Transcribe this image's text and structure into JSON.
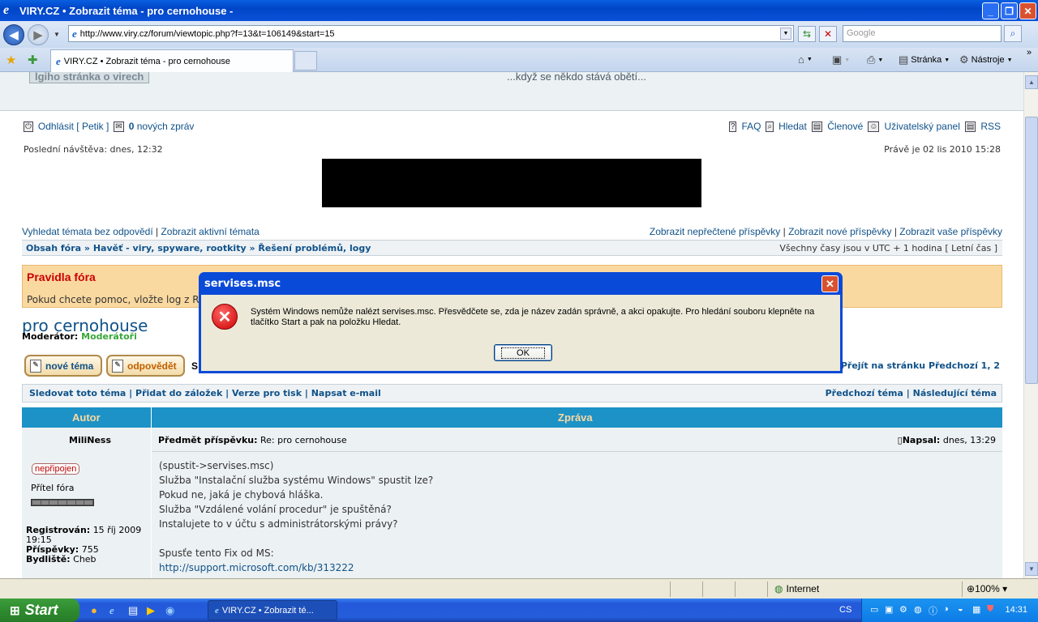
{
  "window": {
    "title": "VIRY.CZ • Zobrazit téma - pro cernohouse -"
  },
  "address": {
    "url": "http://www.viry.cz/forum/viewtopic.php?f=13&t=106149&start=15",
    "search_placeholder": "Google"
  },
  "tabs": [
    {
      "label": "VIRY.CZ • Zobrazit téma - pro cernohouse"
    }
  ],
  "toolbar": {
    "page_label": "Stránka",
    "tools_label": "Nástroje"
  },
  "site": {
    "logo_text": "lgiho stránka o virech",
    "slogan": "...když se někdo stává obětí...",
    "logout": "Odhlásit [ Petik ]",
    "new_messages_count": "0",
    "new_messages": "nových zpráv",
    "faq": "FAQ",
    "search": "Hledat",
    "members": "Členové",
    "user_panel": "Uživatelský panel",
    "rss": "RSS",
    "last_visit": "Poslední návštěva: dnes, 12:32",
    "now": "Právě je 02 lis 2010 15:28",
    "left_links": [
      "Vyhledat témata bez odpovědí",
      "Zobrazit aktivní témata"
    ],
    "right_links": [
      "Zobrazit nepřečtené příspěvky",
      "Zobrazit nové příspěvky",
      "Zobrazit vaše příspěvky"
    ],
    "breadcrumbs": [
      "Obsah fóra",
      "Havěť - viry, spyware, rootkity",
      "Řešení problémů, logy"
    ],
    "timezone": "Všechny časy jsou v UTC + 1 hodina [ Letní čas ]",
    "rules_title": "Pravidla fóra",
    "rules_text": "Pokud chcete pomoc, vložte log z RS",
    "topic_title": "pro cernohouse",
    "moderator_label": "Moderátor:",
    "moderator_value": "Moderátoři",
    "btn_new": "nové téma",
    "btn_reply": "odpovědět",
    "st_fragment": "S",
    "pagination": "Přejít na stránku Předchozí  1, 2",
    "topic_links": [
      "Sledovat toto téma",
      "Přidat do záložek",
      "Verze pro tisk",
      "Napsat e-mail"
    ],
    "topic_nav": "Předchozí téma | Následující téma",
    "col_author": "Autor",
    "col_message": "Zpráva"
  },
  "post": {
    "author": "MiliNess",
    "subject_label": "Předmět příspěvku:",
    "subject": "Re: pro cernohouse",
    "posted_label": "Napsal:",
    "posted": "dnes, 13:29",
    "status": "nepřipojen",
    "rank": "Přítel fóra",
    "registered_label": "Registrován:",
    "registered": "15 říj 2009",
    "registered_time": "19:15",
    "posts_label": "Příspěvky:",
    "posts": "755",
    "location_label": "Bydliště:",
    "location": "Cheb",
    "body": [
      "(spustit->servises.msc)",
      "Služba \"Instalační služba systému Windows\" spustit lze?",
      "Pokud ne, jaká je chybová hláška.",
      "Služba \"Vzdálené volání procedur\" je spuštěná?",
      "Instalujete to v účtu s administrátorskými právy?",
      "",
      "Spusťe tento Fix od MS:"
    ],
    "link": "http://support.microsoft.com/kb/313222"
  },
  "dialog": {
    "title": "servises.msc",
    "message": "Systém Windows nemůže nalézt servises.msc. Přesvědčete se, zda je název zadán správně, a akci opakujte. Pro hledání souboru klepněte na tlačítko Start a pak na položku Hledat.",
    "ok": "OK"
  },
  "statusbar": {
    "zone": "Internet",
    "zoom": "100%"
  },
  "taskbar": {
    "start": "Start",
    "task": "VIRY.CZ • Zobrazit té...",
    "lang": "CS",
    "clock": "14:31"
  }
}
